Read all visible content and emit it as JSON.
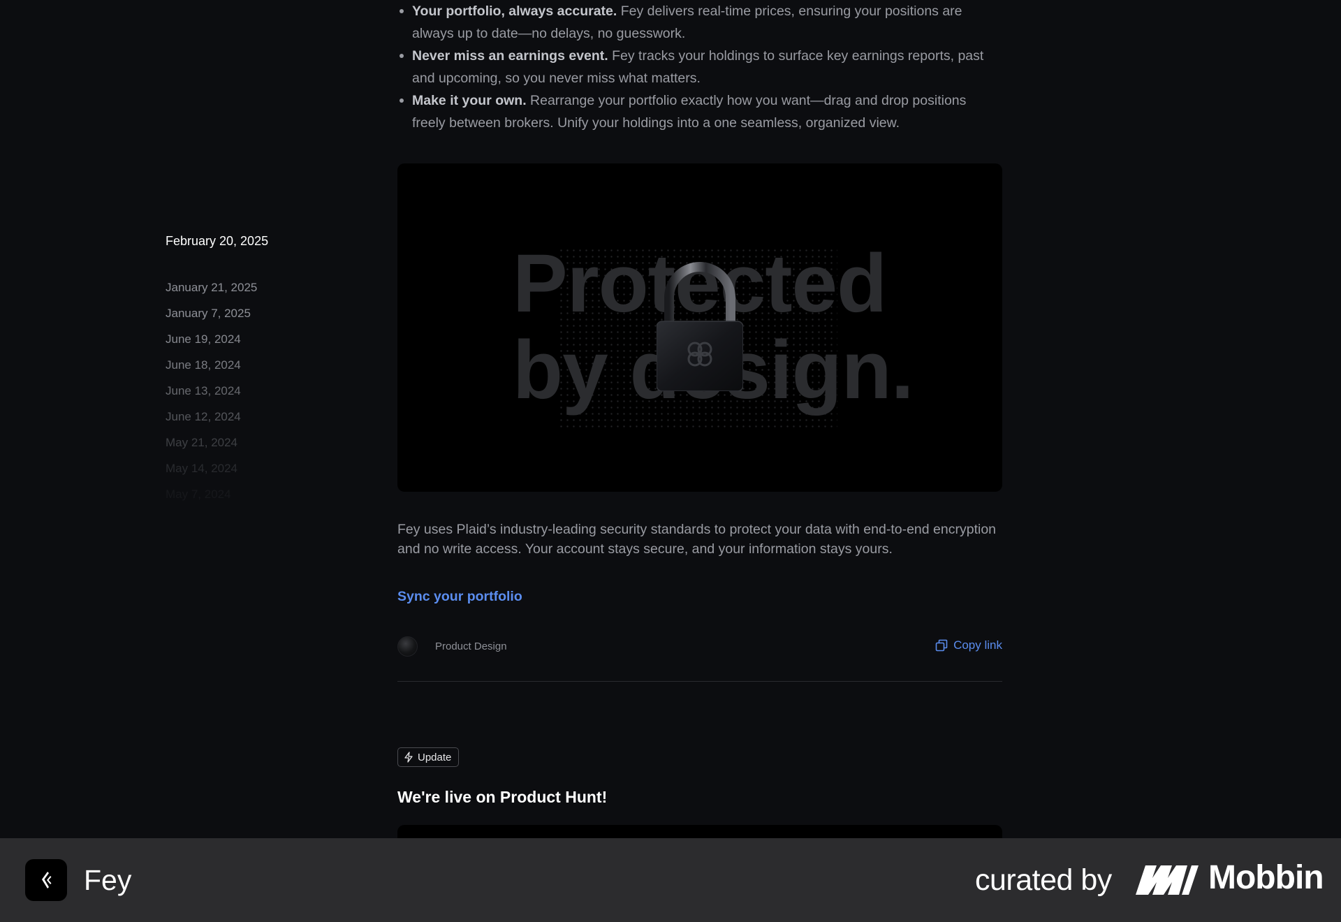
{
  "sidebar": {
    "active_date": "February 20, 2025",
    "dates": [
      "January 21, 2025",
      "January 7, 2025",
      "June 19, 2024",
      "June 18, 2024",
      "June 13, 2024",
      "June 12, 2024",
      "May 21, 2024",
      "May 14, 2024",
      "May 7, 2024"
    ]
  },
  "article": {
    "bullets": [
      {
        "bold": "Your portfolio, always accurate.",
        "text": " Fey delivers real-time prices, ensuring your positions are always up to date—no delays, no guesswork."
      },
      {
        "bold": "Never miss an earnings event.",
        "text": " Fey tracks your holdings to surface key earnings reports, past and upcoming, so you never miss what matters."
      },
      {
        "bold": "Make it your own.",
        "text": " Rearrange your portfolio exactly how you want—drag and drop positions freely between brokers. Unify your holdings into a one seamless, organized view."
      }
    ],
    "hero": {
      "line1": "Protected",
      "line2": "by design.",
      "icon": "padlock-icon"
    },
    "body": "Fey uses Plaid’s industry-leading security standards to protect your data with end-to-end encryption and no write access. Your account stays secure, and your information stays yours.",
    "cta": "Sync your portfolio",
    "category": "Product Design",
    "copy_link": "Copy link"
  },
  "next_post": {
    "badge": "Update",
    "title": "We're live on Product Hunt!"
  },
  "footer": {
    "app_name": "Fey",
    "curated_by": "curated by",
    "brand": "Mobbin"
  },
  "colors": {
    "background": "#0c0d10",
    "accent": "#5b8def",
    "footer_bg": "#2c2c2e"
  }
}
